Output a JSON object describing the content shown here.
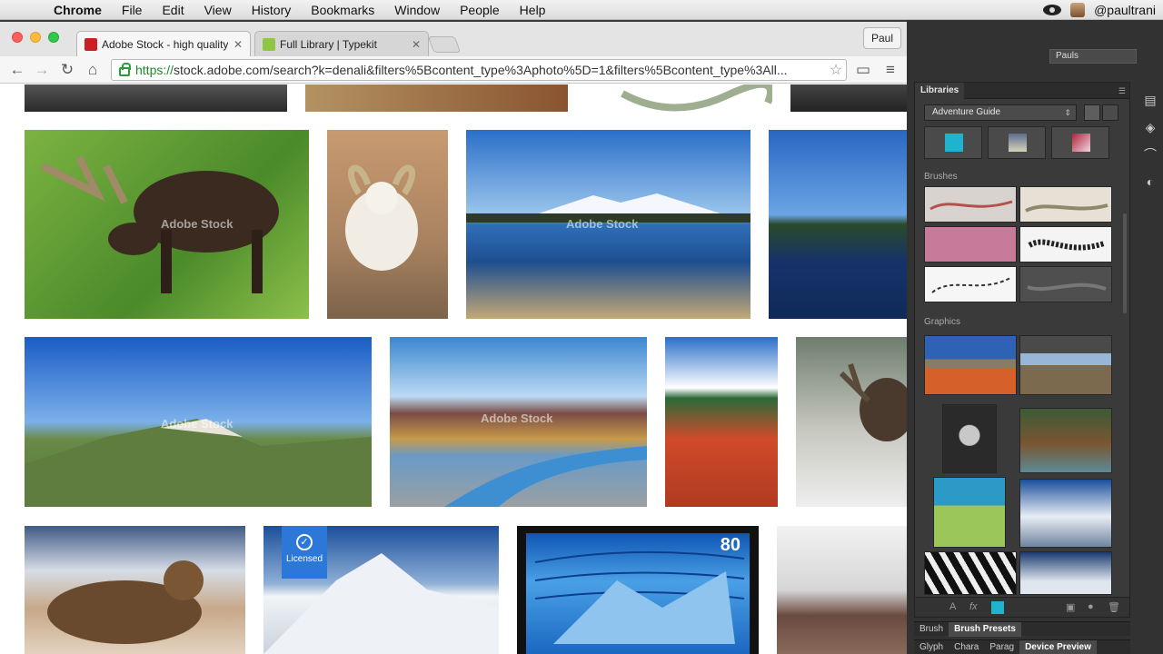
{
  "menubar": {
    "app": "Chrome",
    "items": [
      "File",
      "Edit",
      "View",
      "History",
      "Bookmarks",
      "Window",
      "People",
      "Help"
    ],
    "user": "@paultrani"
  },
  "browser": {
    "tabs": [
      {
        "title": "Adobe Stock - high quality",
        "color": "#cc1f24"
      },
      {
        "title": "Full Library | Typekit",
        "color": "#8ec641"
      }
    ],
    "profile": "Paul",
    "url_scheme": "https://",
    "url_rest": "stock.adobe.com/search?k=denali&filters%5Bcontent_type%3Aphoto%5D=1&filters%5Bcontent_type%3All..."
  },
  "stock": {
    "watermark": "Adobe Stock",
    "licensed_label": "Licensed",
    "stamp_value": "80"
  },
  "photoshop": {
    "workspace": "Pauls",
    "panel_tab": "Libraries",
    "library_name": "Adventure Guide",
    "section_brushes": "Brushes",
    "section_graphics": "Graphics",
    "swatches": [
      "#1fb3cf",
      "#9aa0a6",
      "#b0243a"
    ],
    "tabs_row1": [
      "Brush",
      "Brush Presets"
    ],
    "tabs_row2": [
      "Glyph",
      "Chara",
      "Parag",
      "Device Preview"
    ]
  }
}
